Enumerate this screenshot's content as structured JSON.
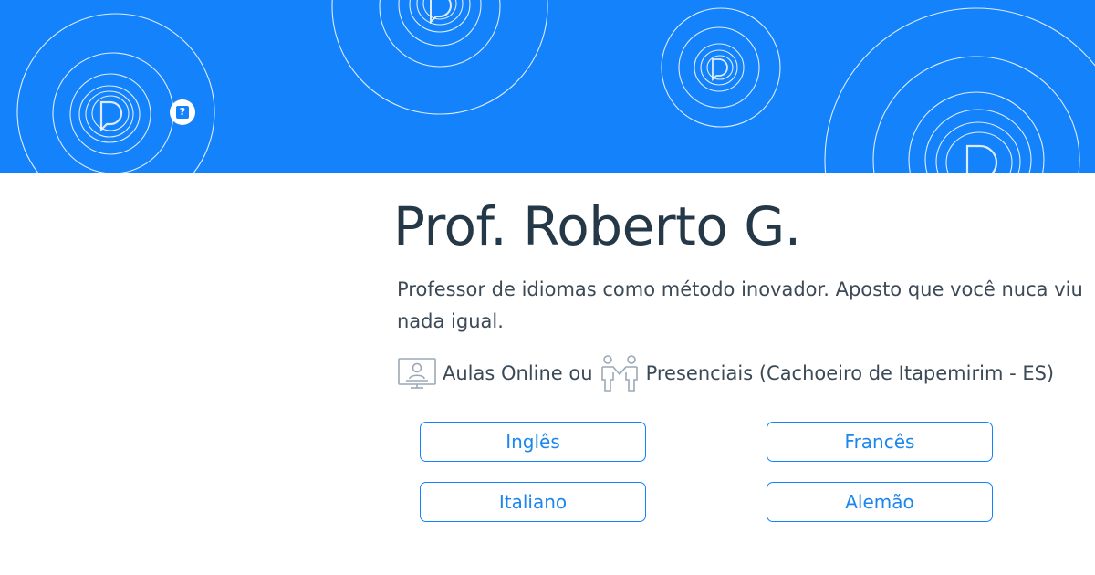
{
  "colors": {
    "banner": "#1482fa",
    "title": "#253848",
    "text": "#3c4a57",
    "accent": "#1a86ee"
  },
  "badge": {
    "icon": "help-badge-icon",
    "glyph": "?"
  },
  "profile": {
    "name": "Prof. Roberto G.",
    "description": "Professor de idiomas como método inovador. Aposto que você nuca viu nada igual."
  },
  "modes": {
    "online_icon": "computer-screen-user-icon",
    "online_label": "Aulas Online ou",
    "inperson_icon": "people-handshake-icon",
    "inperson_label": "Presenciais (Cachoeiro de Itapemirim - ES)"
  },
  "languages": [
    "Inglês",
    "Francês",
    "Italiano",
    "Alemão"
  ]
}
